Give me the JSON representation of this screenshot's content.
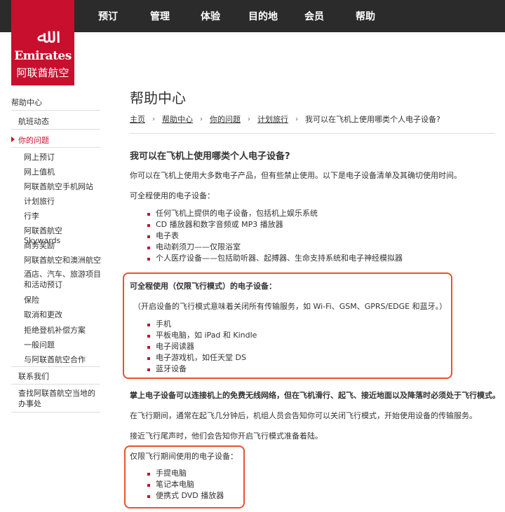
{
  "nav": {
    "items": [
      "预订",
      "管理",
      "体验",
      "目的地",
      "会员",
      "帮助"
    ]
  },
  "logo": {
    "brand": "Emirates",
    "brand_cn": "阿联酋航空"
  },
  "sidebar": {
    "help_center": "帮助中心",
    "flight_status": "航班动态",
    "your_question": "你的问题",
    "sub_items": [
      "网上预订",
      "网上值机",
      "阿联酋航空手机网站",
      "计划旅行",
      "行李",
      "阿联酋航空 Skywards",
      "商务奖励",
      "阿联酋航空和澳洲航空",
      "酒店、汽车、旅游项目和活动预订",
      "保险",
      "取消和更改",
      "拒绝登机补偿方案",
      "一般问题",
      "与阿联酋航空合作"
    ],
    "contact": "联系我们",
    "find_office": "查找阿联酋航空当地的办事处"
  },
  "main": {
    "title": "帮助中心",
    "breadcrumb": [
      "主页",
      "帮助中心",
      "你的问题",
      "计划旅行"
    ],
    "breadcrumb_current": "我可以在飞机上使用哪类个人电子设备?",
    "heading": "我可以在飞机上使用哪类个人电子设备?",
    "intro": "你可以在飞机上使用大多数电子产品，但有些禁止使用。以下是电子设备清单及其确切使用时间。",
    "all_flight_label": "可全程使用的电子设备：",
    "all_flight_items": [
      "任何飞机上提供的电子设备，包括机上娱乐系统",
      "CD 播放器和数字音频或 MP3 播放器",
      "电子表",
      "电动剃须刀——仅限浴室",
      "个人医疗设备——包括助听器、起搏器、生命支持系统和电子神经模拟器"
    ],
    "flight_mode_label": "可全程使用（仅限飞行模式）的电子设备：",
    "flight_mode_note": "（开启设备的飞行模式意味着关闭所有传输服务，如 Wi-Fi、GSM、GPRS/EDGE 和蓝牙。）",
    "flight_mode_items": [
      "手机",
      "平板电脑，如 iPad 和 Kindle",
      "电子阅读器",
      "电子游戏机，如任天堂 DS",
      "蓝牙设备"
    ],
    "wireless_note": "掌上电子设备可以连接机上的免费无线网络，但在飞机滑行、起飞、接近地面以及降落时必须处于飞行模式。",
    "flight_period_note": "在飞行期间，通常在起飞几分钟后，机组人员会告知你可以关闭飞行模式，开始使用设备的传输服务。",
    "landing_note": "接近飞行尾声时，他们会告知你开启飞行模式准备着陆。",
    "in_flight_label": "仅限飞行期间使用的电子设备：",
    "in_flight_items": [
      "手提电脑",
      "笔记本电脑",
      "便携式 DVD 播放器"
    ]
  },
  "colors": {
    "brand_red": "#c8102e",
    "highlight": "#e8532c",
    "topbar": "#2b2b2b"
  }
}
